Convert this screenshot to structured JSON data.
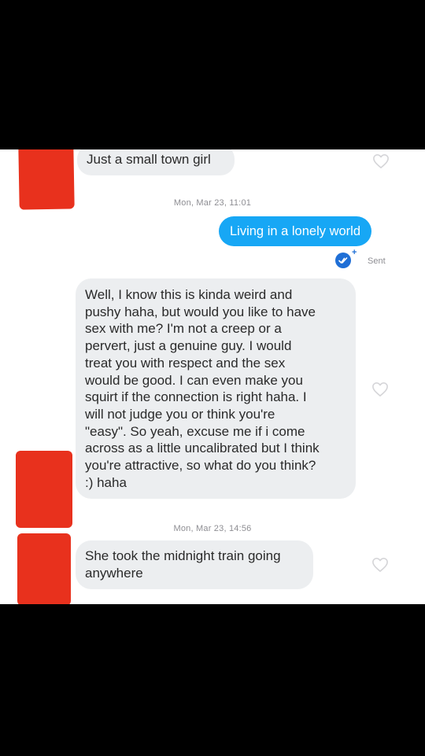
{
  "messages": {
    "m1": {
      "text": "Just a small town girl"
    },
    "ts1": "Mon, Mar 23, 11:01",
    "m2": {
      "text": "Living in a lonely world"
    },
    "status": "Sent",
    "m3": {
      "lines": [
        "Well, I know this is kinda weird and",
        "pushy haha, but would you like to have",
        "sex with me? I'm not a creep or a",
        "pervert, just a genuine guy. I would",
        "treat you with respect and the sex",
        "would be good. I can even make you",
        "squirt if the connection is right haha. I",
        "will not judge you or think you're",
        "\"easy\". So yeah, excuse me if i come",
        "across as a little uncalibrated but I think",
        "you're attractive, so what do you think?",
        ":) haha"
      ]
    },
    "ts2": "Mon, Mar 23, 14:56",
    "m4": {
      "lines": [
        "She took the midnight train going",
        "anywhere"
      ]
    }
  },
  "icons": {
    "like": "heart-outline-icon",
    "read_receipt": "double-check-icon"
  },
  "colors": {
    "outgoing_bubble": "#17a7f5",
    "incoming_bubble": "#eceef0",
    "redaction": "#e8311d",
    "timestamp": "#8e8e93"
  }
}
